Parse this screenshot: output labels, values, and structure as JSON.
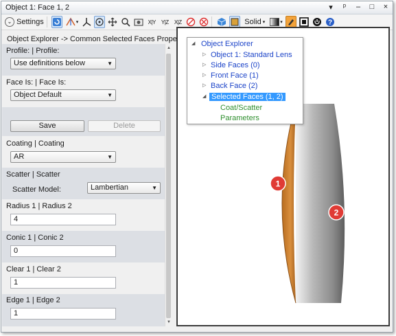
{
  "window": {
    "title": "Object 1: Face 1, 2",
    "controls": {
      "menu": "▾",
      "pin": "ᵖ",
      "minimize": "–",
      "maximize": "□",
      "close": "×"
    }
  },
  "toolbar": {
    "settings_label": "Settings",
    "axis_xy": "X|Y",
    "axis_yz": "Y|Z",
    "axis_xz": "X|Z",
    "render_mode": "Solid",
    "dropdown_glyph": "▾"
  },
  "breadcrumb": "Object Explorer ->  Common Selected Faces Properties",
  "panel": {
    "profile": {
      "label": "Profile: | Profile:",
      "value": "Use definitions below"
    },
    "face_is": {
      "label": "Face Is: | Face Is:",
      "value": "Object Default"
    },
    "save_label": "Save",
    "delete_label": "Delete",
    "coating": {
      "label": "Coating | Coating",
      "value": "AR"
    },
    "scatter": {
      "label": "Scatter | Scatter",
      "model_label": "Scatter Model:",
      "model_value": "Lambertian"
    },
    "radius": {
      "label": "Radius 1 | Radius 2",
      "value": "4"
    },
    "conic": {
      "label": "Conic 1 | Conic 2",
      "value": "0"
    },
    "clear": {
      "label": "Clear 1 | Clear 2",
      "value": "1"
    },
    "edge": {
      "label": "Edge 1 | Edge 2",
      "value": "1"
    }
  },
  "tree": {
    "root": "Object Explorer",
    "items": [
      {
        "label": "Object 1: Standard Lens",
        "color": "blue"
      },
      {
        "label": "Side Faces (0)",
        "color": "blue"
      },
      {
        "label": "Front Face (1)",
        "color": "blue"
      },
      {
        "label": "Back Face (2)",
        "color": "blue"
      },
      {
        "label": "Selected Faces (1, 2)",
        "color": "selected"
      }
    ],
    "children": [
      {
        "label": "Coat/Scatter"
      },
      {
        "label": "Parameters"
      }
    ]
  },
  "viewport": {
    "face_markers": [
      "1",
      "2"
    ],
    "colors": {
      "front_face": "#d08a3a",
      "lens_body": "#9a9a9a",
      "marker": "#e03b35"
    }
  }
}
